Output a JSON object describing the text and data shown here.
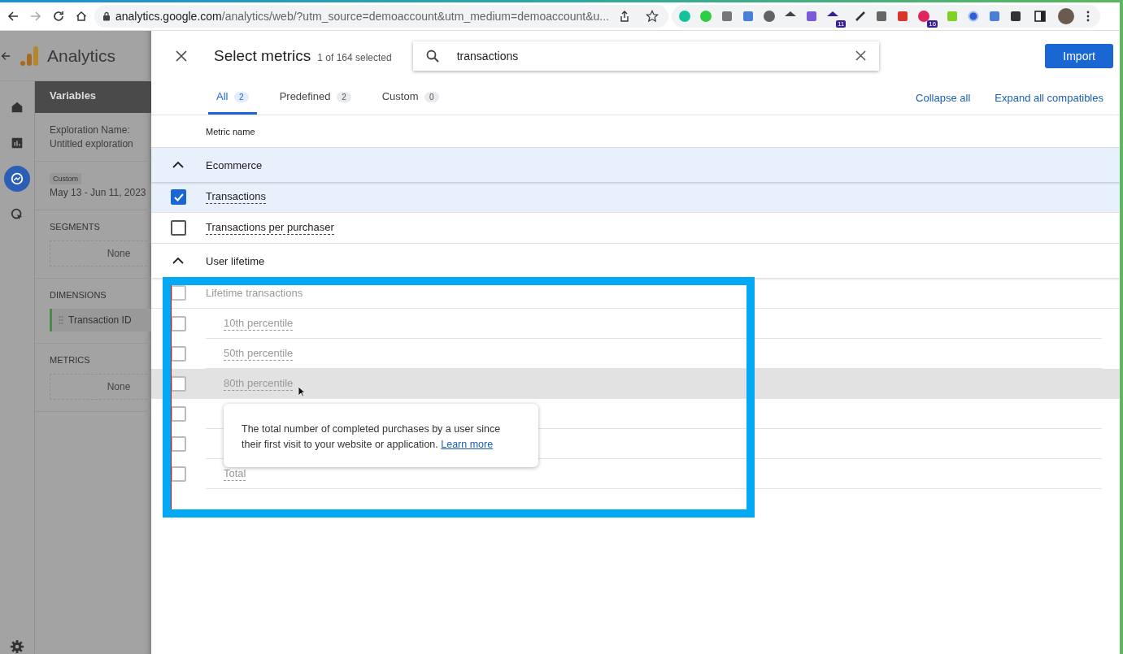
{
  "browser": {
    "url_host": "analytics.google.com",
    "url_path": "/analytics/web/?utm_source=demoaccount&utm_medium=demoaccount&u...",
    "extensions": [
      {
        "kind": "grammar"
      },
      {
        "kind": "puzzle-green"
      },
      {
        "kind": "camera"
      },
      {
        "kind": "translate"
      },
      {
        "kind": "lock-clock"
      },
      {
        "kind": "umbrella"
      },
      {
        "kind": "doc-purple"
      },
      {
        "kind": "cap",
        "badge": "11"
      },
      {
        "kind": "dropper"
      },
      {
        "kind": "ticket"
      },
      {
        "kind": "red-grid"
      },
      {
        "kind": "red-circle",
        "badge": "16"
      },
      {
        "kind": "green-square"
      },
      {
        "kind": "blue-ring"
      },
      {
        "kind": "reader"
      },
      {
        "kind": "puzzle"
      }
    ]
  },
  "app": {
    "title": "Analytics",
    "nav": [
      {
        "kind": "home",
        "selected": false
      },
      {
        "kind": "reports",
        "selected": false
      },
      {
        "kind": "explore",
        "selected": true
      },
      {
        "kind": "advertising",
        "selected": false
      }
    ],
    "panel": {
      "title": "Variables",
      "name_label": "Exploration Name:",
      "name_value": "Untitled exploration",
      "date_chip": "Custom",
      "date_range": "May 13 - Jun 11, 2023",
      "sections": [
        {
          "title": "SEGMENTS",
          "items": [
            {
              "label": "None",
              "kind": "empty"
            }
          ]
        },
        {
          "title": "DIMENSIONS",
          "items": [
            {
              "label": "Transaction ID",
              "kind": "chip"
            }
          ]
        },
        {
          "title": "METRICS",
          "items": [
            {
              "label": "None",
              "kind": "empty"
            }
          ]
        }
      ]
    }
  },
  "dialog": {
    "title": "Select metrics",
    "count": "1 of 164 selected",
    "search": {
      "value": "transactions"
    },
    "import_button": "Import",
    "tabs": [
      {
        "label": "All",
        "count": "2",
        "selected": true
      },
      {
        "label": "Predefined",
        "count": "2",
        "selected": false
      },
      {
        "label": "Custom",
        "count": "0",
        "selected": false
      }
    ],
    "links": [
      "Collapse all",
      "Expand all compatibles"
    ],
    "column_header": "Metric name",
    "groups": [
      {
        "name": "Ecommerce",
        "expanded": true,
        "items": [
          {
            "label": "Transactions",
            "checked": true,
            "disabled": false
          },
          {
            "label": "Transactions per purchaser",
            "checked": false,
            "disabled": false
          }
        ]
      },
      {
        "name": "User lifetime",
        "expanded": true,
        "items": [
          {
            "label": "Lifetime transactions",
            "checked": false,
            "disabled": true,
            "children": [
              {
                "label": "10th percentile",
                "checked": false,
                "hovered": false
              },
              {
                "label": "50th percentile",
                "checked": false,
                "hovered": false
              },
              {
                "label": "80th percentile",
                "checked": false,
                "hovered": true
              },
              {
                "checked": false,
                "hovered": false
              },
              {
                "checked": false,
                "hovered": false
              },
              {
                "label": "Total",
                "checked": false,
                "hovered": false
              }
            ]
          }
        ]
      }
    ],
    "tooltip": {
      "text": "The total number of completed purchases by a user since their first visit to your website or application.",
      "link": "Learn more"
    }
  }
}
